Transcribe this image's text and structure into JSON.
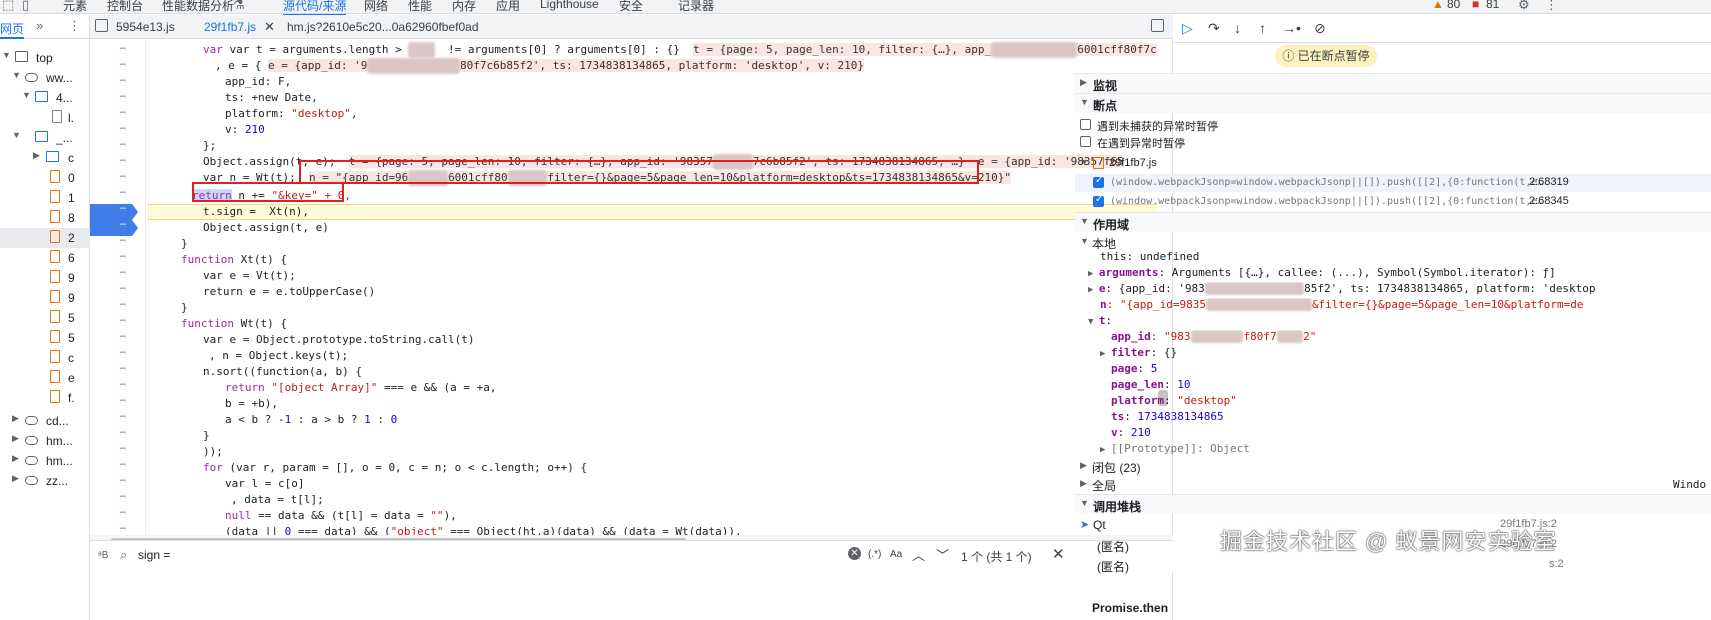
{
  "top_tabs": {
    "elements": "元素",
    "console": "控制台",
    "perf_insights": "性能数据分析",
    "sources": "源代码/来源",
    "network": "网络",
    "performance": "性能",
    "memory": "内存",
    "application": "应用",
    "lighthouse": "Lighthouse",
    "security": "安全",
    "recorder": "记录器",
    "warnings": "80",
    "errors": "81"
  },
  "navigator": {
    "tab_label": "网页",
    "items": [
      {
        "label": "top"
      },
      {
        "label": "ww..."
      },
      {
        "label": "4..."
      },
      {
        "label": "l."
      },
      {
        "label": "_..."
      },
      {
        "label": "c"
      },
      {
        "label": "0"
      },
      {
        "label": "1"
      },
      {
        "label": "8"
      },
      {
        "label": "2"
      },
      {
        "label": "6"
      },
      {
        "label": "9"
      },
      {
        "label": "9"
      },
      {
        "label": "5"
      },
      {
        "label": "5"
      },
      {
        "label": "c"
      },
      {
        "label": "e"
      },
      {
        "label": "f."
      },
      {
        "label": "cd..."
      },
      {
        "label": "hm..."
      },
      {
        "label": "hm..."
      },
      {
        "label": "zz..."
      }
    ]
  },
  "file_tabs": [
    {
      "label": "5954e13.js"
    },
    {
      "label": "29f1fb7.js"
    },
    {
      "label": "hm.js?2610e5c20...0a62960fbef0ad"
    }
  ],
  "code": {
    "l1a": "var t = arguments.length > ",
    "l1b": " != arguments[0] ? arguments[0] : {}",
    "l1c": "t = {page: 5, page_len: 10, filter: {…}, app_",
    "l1d": "6001cff80f7c6",
    "l2a": ", e = {",
    "l2b": "e = {app_id: '9",
    "l2c": "80f7c6b85f2', ts: 1734838134865, platform: 'desktop', v: 210}",
    "l3": "app_id: F,",
    "l4": "ts: +new Date,",
    "l5a": "platform: ",
    "l5b": "\"desktop\"",
    "l5c": ",",
    "l6a": "v: ",
    "l6b": "210",
    "l7": "};",
    "l8a": "Object.assign(t, e);",
    "l8b": "t = {page: 5, page_len: 10, filter: {…}, app_id: '98357",
    "l8c": "7c6b85f2', ts: 1734838134865, …}  e = {app_id: '98357f65",
    "l9a": "var n = Wt(t);",
    "l9b": "n = \"{app_id=96",
    "l9c": "6001cff80",
    "l9d": "filter={}&page=5&page_len=10&platform=desktop&ts=1734838134865&v=210}\"",
    "l10a": "return",
    "l10b": " n += ",
    "l10c": "\"&key=\" + 0,",
    "l11": "t.sign =  Xt(n),",
    "l12": "Object.assign(t, e)",
    "l13": "}",
    "l14a": "function",
    "l14b": " Xt(t) {",
    "l15": "var e = Vt(t);",
    "l16": "return e = e.toUpperCase()",
    "l17": "}",
    "l18a": "function",
    "l18b": " Wt(t) {",
    "l19": "var e = Object.prototype.toString.call(t)",
    "l20": ", n = Object.keys(t);",
    "l21": "n.sort((function(a, b) {",
    "l22a": "return ",
    "l22b": "\"[object Array]\"",
    "l22c": " === e && (a = +a,",
    "l23": "b = +b),",
    "l24a": "a < b ? ",
    "l24b": "-1",
    "l24c": " : a > b ? ",
    "l24d": "1",
    "l24e": " : ",
    "l24f": "0",
    "l25": "}",
    "l26": "));",
    "l27a": "for",
    "l27b": " (var r, param = [], o = 0, c = n; o < c.length; o++) {",
    "l28": "var l = c[o]",
    "l29": ", data = t[l];",
    "l30a": "null",
    "l30b": " == data && (t[l] = data = ",
    "l30c": "\"\"",
    "l30d": "),",
    "l31a": "(data || ",
    "l31b": "0",
    "l31c": " === data) && (",
    "l31d": "\"object\"",
    "l31e": " === Object(ht.a)(data) && (data = Wt(data)),"
  },
  "search": {
    "case_label": "Aa",
    "value": "sign =",
    "regex_label": "(.*)",
    "match_case_label": "Aa",
    "count": "1 个 (共 1 个)"
  },
  "debugger": {
    "paused": "已在断点暂停",
    "watch": "监视",
    "breakpoints": "断点",
    "pause_uncaught": "遇到未捕获的异常时暂停",
    "pause_caught": "在遇到异常时暂停",
    "bp_file": "29f1fb7.js",
    "bp1_code": "(window.webpackJsonp=window.webpackJsonp||[]).push([[2],{0:function(t,e…",
    "bp1_loc": "2:68319",
    "bp2_code": "(window.webpackJsonp=window.webpackJsonp||[]).push([[2],{0:function(t,e…",
    "bp2_loc": "2:68345",
    "scope": "作用域",
    "local": "本地",
    "this_line": "this: undefined",
    "arguments_key": "arguments",
    "arguments_val": ": Arguments [{…}, callee: (...), Symbol(Symbol.iterator): ƒ]",
    "e_key": "e",
    "e_val_a": ": {app_id: '983",
    "e_val_b": "85f2', ts: 1734838134865, platform: 'desktop",
    "n_key": "n",
    "n_val_a": ": \"{app_id=9835",
    "n_val_b": "&filter={}&page=5&page_len=10&platform=de",
    "t_key": "t",
    "app_id_key": "app_id",
    "app_id_a": ": \"983",
    "app_id_b": "f80f7",
    "app_id_c": "2\"",
    "filter_key": "filter",
    "filter_val": ": {}",
    "page_key": "page",
    "page_val": "5",
    "page_len_key": "page_len",
    "page_len_val": "10",
    "platform_key": "platform",
    "platform_val": "\"desktop\"",
    "ts_key": "ts",
    "ts_val": "1734838134865",
    "v_key": "v",
    "v_val": "210",
    "prototype_line": "[[Prototype]]: Object",
    "closure": "闭包 (23)",
    "global": "全局",
    "global_val": "Windo",
    "callstack": "调用堆栈",
    "frame1": "Qt",
    "frame1_loc": "29f1fb7.js:2",
    "frame2": "(匿名)",
    "frame2_loc": "29f1fb7.js:2",
    "frame3": "(匿名)",
    "frame3_loc": "s:2",
    "frame4": "Promise.then"
  },
  "watermark": "掘金技术社区 @ 蚁景网安实验室"
}
